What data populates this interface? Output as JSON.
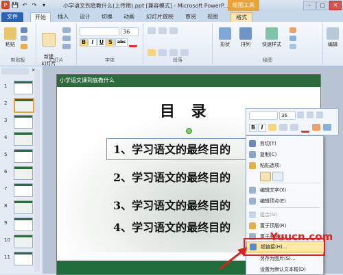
{
  "titlebar": {
    "title": "小学语文到底教什么(上传用).ppt [兼容模式] - Microsoft PowerP...",
    "context_tab": "绘图工具",
    "min": "–",
    "max": "□",
    "close": "✕"
  },
  "tabs": {
    "file": "文件",
    "items": [
      "开始",
      "插入",
      "设计",
      "切换",
      "动画",
      "幻灯片放映",
      "审阅",
      "视图",
      "格式"
    ]
  },
  "ribbon": {
    "paste": "粘贴",
    "clipboard_label": "剪贴板",
    "new_slide": "新建\n幻灯片",
    "slides_label": "幻灯片",
    "font_size": "36",
    "font_label": "字体",
    "paragraph_label": "段落",
    "shapes": "形状",
    "arrange": "排列",
    "quick_styles": "快速样式",
    "drawing_label": "绘图",
    "edit": "编辑",
    "fmt": {
      "bold": "B",
      "italic": "I",
      "underline": "U",
      "shadow": "S",
      "strike": "abc"
    }
  },
  "slides": {
    "numbers": [
      "1",
      "2",
      "3",
      "4",
      "5",
      "6",
      "7",
      "8",
      "9",
      "10",
      "11"
    ]
  },
  "slide": {
    "banner": "小学语文课到底教什么",
    "title": "目 录",
    "items": [
      "1、学习语文的最终目的",
      "2、学习语文的最终目的",
      "3、学习语文的最终目的",
      "4、学习语文的最终目的"
    ]
  },
  "minitoolbar": {
    "font_size": "36"
  },
  "context_menu": {
    "items": [
      "剪切(T)",
      "复制(C)",
      "粘贴选项:",
      "",
      "编辑文字(X)",
      "编辑顶点(E)",
      "组合(G)",
      "置于顶层(R)",
      "置于底层(K)",
      "超链接(H)...",
      "另存为图片(S)...",
      "设置为默认文本框(D)"
    ]
  },
  "watermark": "Yuucn.com",
  "colors": {
    "accent": "#e6a33b",
    "highlight": "#e02020",
    "banner": "#2e6b3c"
  }
}
